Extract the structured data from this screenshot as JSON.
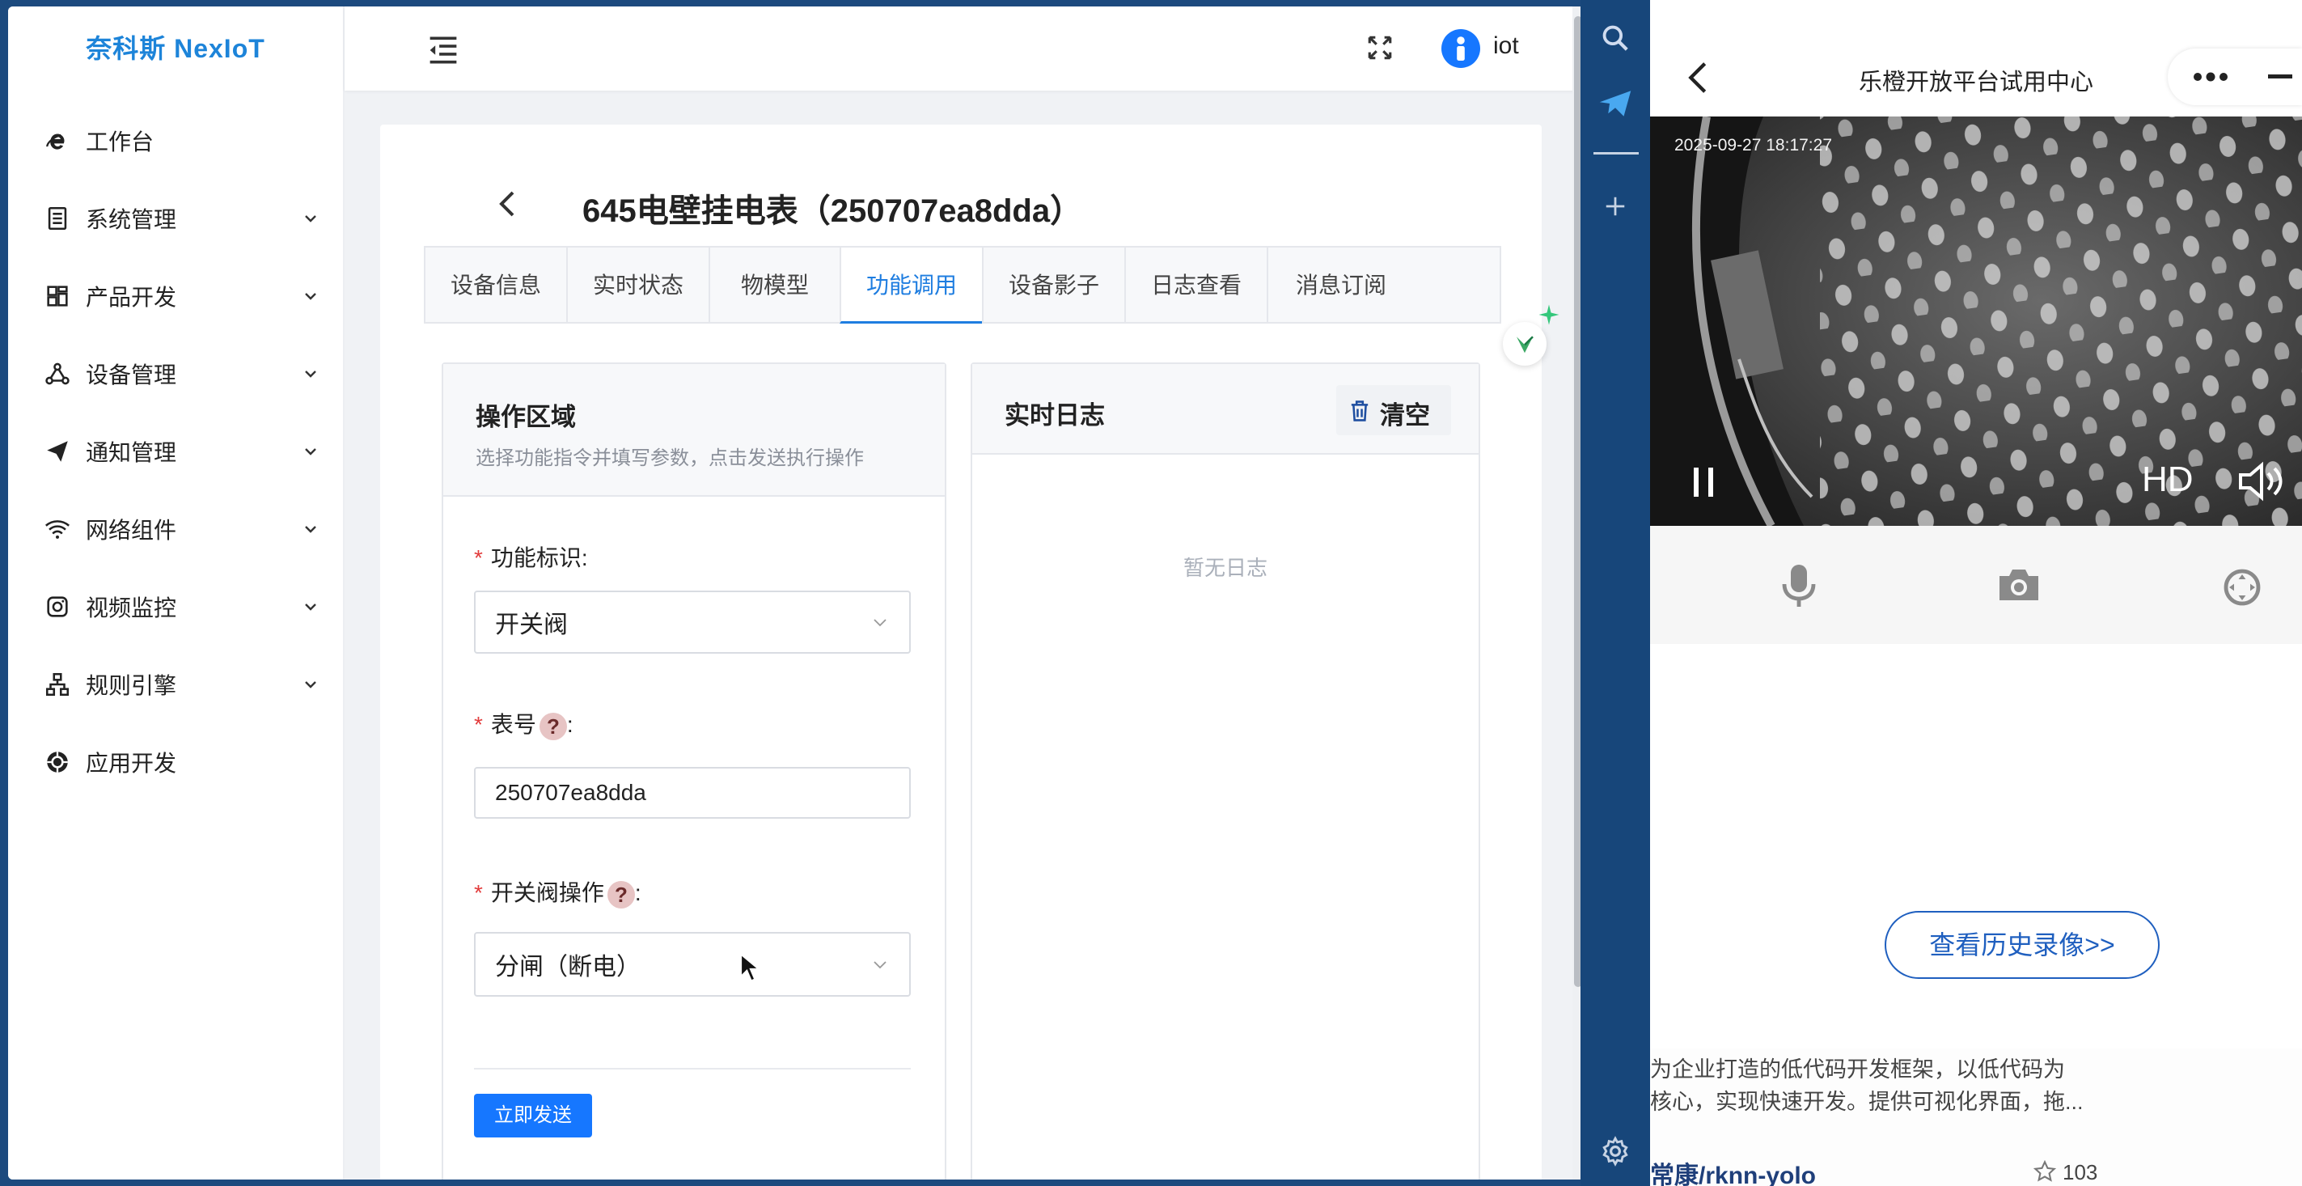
{
  "brand": "奈科斯 NexIoT",
  "user": {
    "name": "iot"
  },
  "sidebar": {
    "items": [
      {
        "label": "工作台",
        "icon": "ie-icon",
        "expandable": false
      },
      {
        "label": "系统管理",
        "icon": "list-icon",
        "expandable": true
      },
      {
        "label": "产品开发",
        "icon": "grid-icon",
        "expandable": true
      },
      {
        "label": "设备管理",
        "icon": "nodes-icon",
        "expandable": true
      },
      {
        "label": "通知管理",
        "icon": "send-icon",
        "expandable": true
      },
      {
        "label": "网络组件",
        "icon": "wifi-icon",
        "expandable": true
      },
      {
        "label": "视频监控",
        "icon": "camera-icon",
        "expandable": true
      },
      {
        "label": "规则引擎",
        "icon": "sitemap-icon",
        "expandable": true
      },
      {
        "label": "应用开发",
        "icon": "app-icon",
        "expandable": false
      }
    ]
  },
  "page": {
    "title": "645电壁挂电表（250707ea8dda）"
  },
  "tabs": [
    {
      "label": "设备信息",
      "active": false
    },
    {
      "label": "实时状态",
      "active": false
    },
    {
      "label": "物模型",
      "active": false
    },
    {
      "label": "功能调用",
      "active": true
    },
    {
      "label": "设备影子",
      "active": false
    },
    {
      "label": "日志查看",
      "active": false
    },
    {
      "label": "消息订阅",
      "active": false
    }
  ],
  "operation": {
    "title": "操作区域",
    "subtitle": "选择功能指令并填写参数，点击发送执行操作",
    "function_label": "功能标识",
    "function_value": "开关阀",
    "meter_label": "表号",
    "meter_value": "250707ea8dda",
    "valve_label": "开关阀操作",
    "valve_value": "分闸（断电）",
    "colon": ":",
    "send_button": "立即发送"
  },
  "log": {
    "title": "实时日志",
    "clear_button": "清空",
    "empty_text": "暂无日志"
  },
  "mobile": {
    "title": "乐橙开放平台试用中心",
    "video_timestamp": "2025-09-27 18:17:27",
    "hd_label": "HD",
    "history_button": "查看历史录像>>",
    "bg_text_line1": "为企业打造的低代码开发框架，以低代码为",
    "bg_text_line2": "核心，实现快速开发。提供可视化界面，拖...",
    "repo_name": "常康/rknn-yolo",
    "repo_stars": "103"
  },
  "colors": {
    "accent": "#1e7de0",
    "primary_button": "#1677ff",
    "required": "#e23c3c",
    "desktop_bg": "#1c4a7e"
  }
}
